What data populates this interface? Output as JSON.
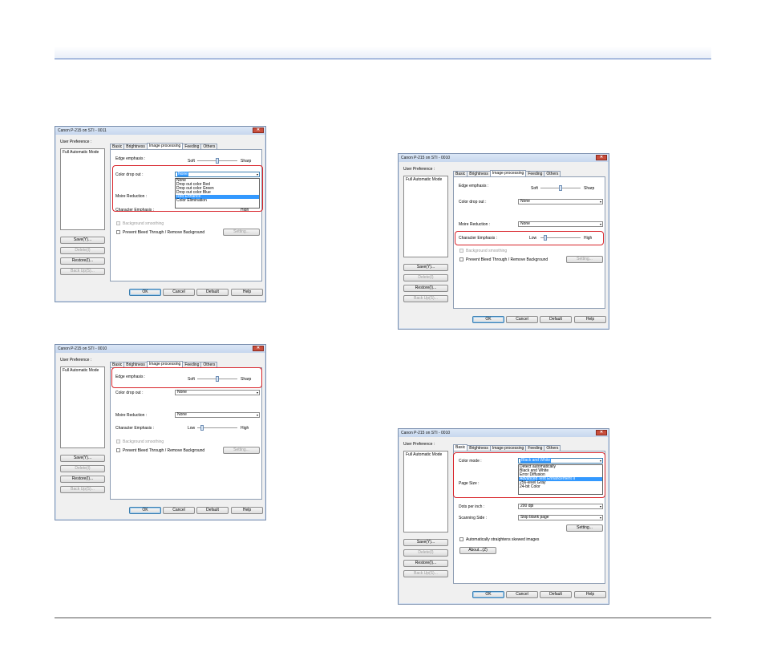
{
  "win_common": {
    "title": "Canon P-215 on STI - 0011",
    "title_alt": "Canon P-215 on STI - 0010",
    "close": "✕",
    "user_pref": "User Preference :",
    "list_item": "Full Automatic Mode",
    "save": "Save(Y)...",
    "delete": "Delete(I)",
    "restore": "Restore(I)...",
    "backup": "Back Up(S)...",
    "ok": "OK",
    "cancel": "Cancel",
    "default": "Default",
    "help": "Help",
    "tabs": [
      "Basic",
      "Brightness",
      "Image processing",
      "Feeding",
      "Others"
    ]
  },
  "imgproc": {
    "edge_label": "Edge emphasis :",
    "soft": "Soft",
    "sharp": "Sharp",
    "color_dropout_label": "Color drop out :",
    "none": "None",
    "moire_label": "Moire Reduction :",
    "char_emphasis_label": "Character Emphasis :",
    "low": "Low",
    "high": "High",
    "bg_smoothing": "Background smoothing",
    "prevent_bleed": "Prevent Bleed Through / Remove Background",
    "setting": "Setting...",
    "dropout_options": [
      "None",
      "Drop out color Red",
      "Drop out color Green",
      "Drop out color Blue",
      "Red Enhance",
      "Color Elimination"
    ]
  },
  "basic": {
    "color_mode_label": "Color mode :",
    "color_mode_value": "Black and White",
    "color_mode_options": [
      "Detect automatically",
      "Black and White",
      "Error Diffusion",
      "Advanced Text Enhancement II",
      "256-level Gray",
      "24-bit Color"
    ],
    "page_size_label": "Page Size :",
    "dpi_label": "Dots per inch :",
    "dpi_value": "200 dpi",
    "side_label": "Scanning Side :",
    "side_value": "Skip blank page",
    "setting": "Setting...",
    "auto_straighten": "Automatically straightens skewed images",
    "about": "About...(Z)"
  }
}
